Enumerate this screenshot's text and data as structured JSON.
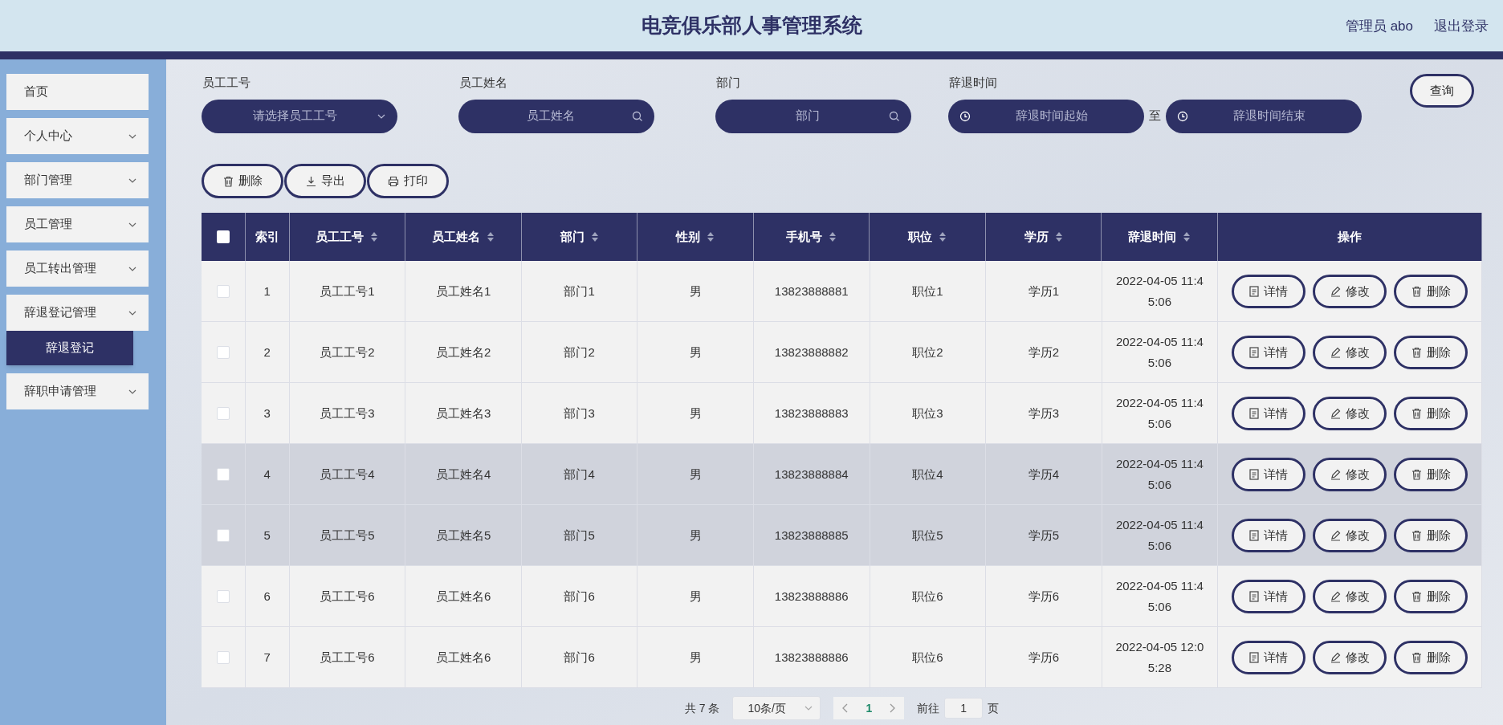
{
  "header": {
    "title": "电竞俱乐部人事管理系统",
    "user": "管理员 abo",
    "logout": "退出登录"
  },
  "sidebar": {
    "items": [
      {
        "label": "首页",
        "has_caret": false
      },
      {
        "label": "个人中心",
        "has_caret": true
      },
      {
        "label": "部门管理",
        "has_caret": true
      },
      {
        "label": "员工管理",
        "has_caret": true
      },
      {
        "label": "员工转出管理",
        "has_caret": true
      },
      {
        "label": "辞退登记管理",
        "has_caret": true,
        "expanded": true,
        "children": [
          {
            "label": "辞退登记",
            "selected": true
          }
        ]
      },
      {
        "label": "辞职申请管理",
        "has_caret": true
      }
    ]
  },
  "filters": [
    {
      "label": "员工工号",
      "kind": "select",
      "placeholder": "请选择员工工号"
    },
    {
      "label": "员工姓名",
      "kind": "search",
      "placeholder": "员工姓名"
    },
    {
      "label": "部门",
      "kind": "search",
      "placeholder": "部门"
    },
    {
      "label": "辞退时间",
      "kind": "daterange",
      "placeholder": "辞退时间起始",
      "separator": "至",
      "placeholder_end": "辞退时间结束"
    }
  ],
  "query_button": "查询",
  "actions": [
    {
      "label": "删除",
      "kind": "delete"
    },
    {
      "label": "导出",
      "kind": "export"
    },
    {
      "label": "打印",
      "kind": "print"
    }
  ],
  "table": {
    "select_all": {
      "checked": false
    },
    "columns": [
      {
        "label": "索引",
        "kind": "text",
        "sortable": false
      },
      {
        "label": "员工工号",
        "kind": "text",
        "sortable": true
      },
      {
        "label": "员工姓名",
        "kind": "text",
        "sortable": true
      },
      {
        "label": "部门",
        "kind": "text",
        "sortable": true
      },
      {
        "label": "性别",
        "kind": "text",
        "sortable": true
      },
      {
        "label": "手机号",
        "kind": "text",
        "sortable": true
      },
      {
        "label": "职位",
        "kind": "text",
        "sortable": true
      },
      {
        "label": "学历",
        "kind": "text",
        "sortable": true
      },
      {
        "label": "辞退时间",
        "kind": "text",
        "sortable": true
      },
      {
        "label": "操作",
        "kind": "actions",
        "sortable": false
      }
    ],
    "rows": [
      {
        "checked": false,
        "highlighted": false,
        "cells": [
          "1",
          "员工工号1",
          "员工姓名1",
          "部门1",
          "男",
          "13823888881",
          "职位1",
          "学历1",
          "2022-04-05 11:45:06"
        ],
        "buttons": [
          {
            "label": "详情",
            "kind": "detail"
          },
          {
            "label": "修改",
            "kind": "edit"
          },
          {
            "label": "删除",
            "kind": "delete"
          }
        ]
      },
      {
        "checked": false,
        "highlighted": false,
        "cells": [
          "2",
          "员工工号2",
          "员工姓名2",
          "部门2",
          "男",
          "13823888882",
          "职位2",
          "学历2",
          "2022-04-05 11:45:06"
        ],
        "buttons": [
          {
            "label": "详情",
            "kind": "detail"
          },
          {
            "label": "修改",
            "kind": "edit"
          },
          {
            "label": "删除",
            "kind": "delete"
          }
        ]
      },
      {
        "checked": false,
        "highlighted": false,
        "cells": [
          "3",
          "员工工号3",
          "员工姓名3",
          "部门3",
          "男",
          "13823888883",
          "职位3",
          "学历3",
          "2022-04-05 11:45:06"
        ],
        "buttons": [
          {
            "label": "详情",
            "kind": "detail"
          },
          {
            "label": "修改",
            "kind": "edit"
          },
          {
            "label": "删除",
            "kind": "delete"
          }
        ]
      },
      {
        "checked": false,
        "highlighted": true,
        "cells": [
          "4",
          "员工工号4",
          "员工姓名4",
          "部门4",
          "男",
          "13823888884",
          "职位4",
          "学历4",
          "2022-04-05 11:45:06"
        ],
        "buttons": [
          {
            "label": "详情",
            "kind": "detail"
          },
          {
            "label": "修改",
            "kind": "edit"
          },
          {
            "label": "删除",
            "kind": "delete"
          }
        ]
      },
      {
        "checked": false,
        "highlighted": true,
        "cells": [
          "5",
          "员工工号5",
          "员工姓名5",
          "部门5",
          "男",
          "13823888885",
          "职位5",
          "学历5",
          "2022-04-05 11:45:06"
        ],
        "buttons": [
          {
            "label": "详情",
            "kind": "detail"
          },
          {
            "label": "修改",
            "kind": "edit"
          },
          {
            "label": "删除",
            "kind": "delete"
          }
        ]
      },
      {
        "checked": false,
        "highlighted": false,
        "cells": [
          "6",
          "员工工号6",
          "员工姓名6",
          "部门6",
          "男",
          "13823888886",
          "职位6",
          "学历6",
          "2022-04-05 11:45:06"
        ],
        "buttons": [
          {
            "label": "详情",
            "kind": "detail"
          },
          {
            "label": "修改",
            "kind": "edit"
          },
          {
            "label": "删除",
            "kind": "delete"
          }
        ]
      },
      {
        "checked": false,
        "highlighted": false,
        "cells": [
          "7",
          "员工工号6",
          "员工姓名6",
          "部门6",
          "男",
          "13823888886",
          "职位6",
          "学历6",
          "2022-04-05 12:05:28"
        ],
        "buttons": [
          {
            "label": "详情",
            "kind": "detail"
          },
          {
            "label": "修改",
            "kind": "edit"
          },
          {
            "label": "删除",
            "kind": "delete"
          }
        ]
      }
    ]
  },
  "pagination": {
    "total": "共 7 条",
    "page_size": "10条/页",
    "pages": [
      {
        "label": "1",
        "selected": true
      }
    ],
    "goto_label": "前往",
    "goto_value": "1",
    "page_unit": "页"
  }
}
